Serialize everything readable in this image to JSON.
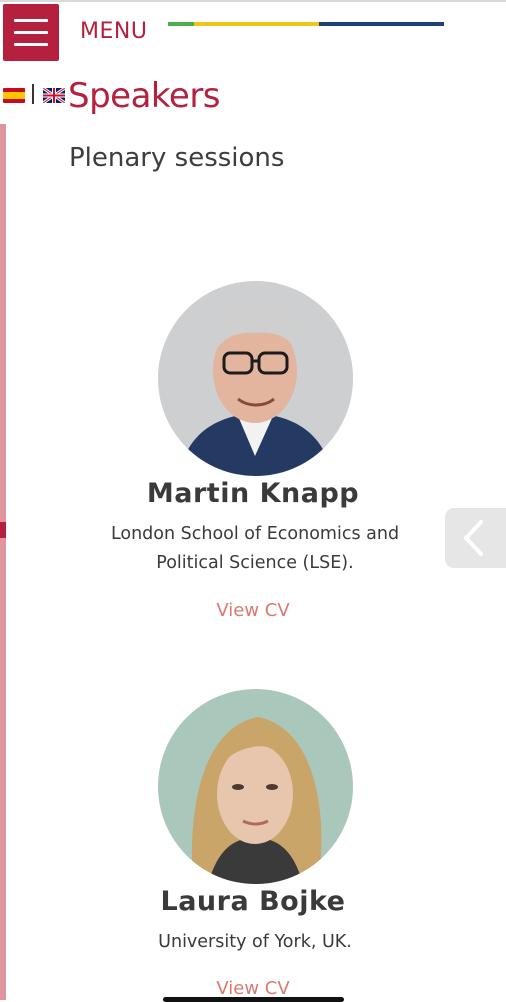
{
  "header": {
    "menu_label": "MENU",
    "stripe_colors": [
      "#4cae4c",
      "#f0c419",
      "#1f3f7a"
    ],
    "accent": "#b5203e"
  },
  "languages": [
    {
      "code": "es",
      "icon": "spain-flag-icon"
    },
    {
      "code": "en",
      "icon": "uk-flag-icon"
    }
  ],
  "page": {
    "title": "Speakers",
    "section": "Plenary sessions"
  },
  "speakers": [
    {
      "name": "Martin Knapp",
      "affiliation": "London School of Economics and Political Science (LSE).",
      "cv_label": "View CV"
    },
    {
      "name": "Laura Bojke",
      "affiliation": "University of York, UK.",
      "cv_label": "View CV"
    }
  ],
  "back_tab": {
    "icon": "chevron-left-icon"
  }
}
